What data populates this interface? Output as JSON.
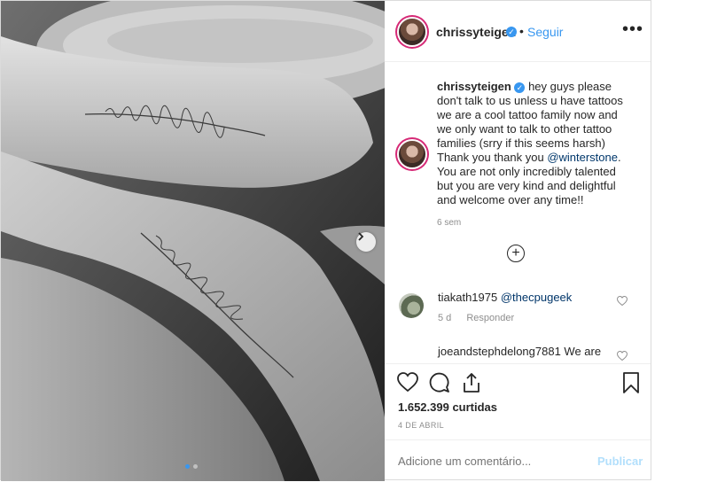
{
  "header": {
    "username": "chrissyteigen",
    "separator": "•",
    "follow_label": "Seguir",
    "more_label": "•••"
  },
  "caption": {
    "username": "chrissyteigen",
    "text_before": " hey guys please don't talk to us unless u have tattoos we are a cool tattoo family now and we only want to talk to other tattoo families (srry if this seems harsh)",
    "text_line2": "Thank you thank you ",
    "mention": "@winterstone",
    "text_after": ". You are not only incredibly talented but you are very kind and delightful and welcome over any time!!",
    "time": "6 sem"
  },
  "load_more_label": "+",
  "comments": [
    {
      "username": "tiakath1975",
      "mention": "@thecpugeek",
      "time": "5 d",
      "reply_label": "Responder"
    },
    {
      "username_and_text": "joeandstephdelong7881 We are"
    }
  ],
  "likes": "1.652.399 curtidas",
  "date": "4 DE ABRIL",
  "add_comment": {
    "placeholder": "Adicione um comentário...",
    "publish_label": "Publicar"
  },
  "carousel": {
    "current_index": 1,
    "total": 2
  },
  "colors": {
    "link": "#3897f0",
    "mention": "#00376b",
    "verified": "#3897f0"
  },
  "icons": [
    "verified-icon",
    "more-icon",
    "chevron-right-icon",
    "add-circle-icon",
    "heart-icon",
    "comment-icon",
    "share-icon",
    "bookmark-icon"
  ]
}
